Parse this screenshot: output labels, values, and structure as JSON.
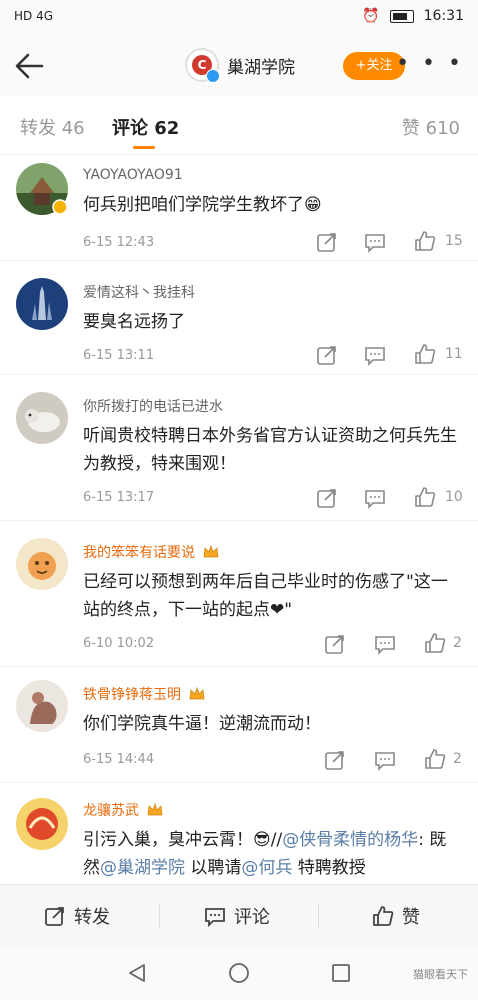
{
  "status": {
    "left": "HD 4G",
    "time": "16:31"
  },
  "header": {
    "account": "巢湖学院",
    "follow": "+关注",
    "more": "• • •"
  },
  "tabs": {
    "repost": "转发 46",
    "comments": "评论 62",
    "likes": "赞 610"
  },
  "comments": [
    {
      "user": "YAOYAOYAO91",
      "text": "何兵别把咱们学院学生教坏了😁",
      "time": "6-15 12:43",
      "likes": "15"
    },
    {
      "user": "爱情这科丶我挂科",
      "text": "要臭名远扬了",
      "time": "6-15 13:11",
      "likes": "11"
    },
    {
      "user": "你所拨打的电话已进水",
      "text": "听闻贵校特聘日本外务省官方认证资助之何兵先生为教授，特来围观！",
      "time": "6-15 13:17",
      "likes": "10"
    },
    {
      "user": "我的笨笨有话要说",
      "text": "已经可以预想到两年后自己毕业时的伤感了\"这一站的终点，下一站的起点❤\"",
      "time": "6-10 10:02",
      "likes": "2"
    },
    {
      "user": "铁骨铮铮蒋玉明",
      "text": "你们学院真牛逼！逆潮流而动！",
      "time": "6-15 14:44",
      "likes": "2"
    },
    {
      "user": "龙骧苏武",
      "text_a": "引污入巢，臭冲云霄！😎//",
      "mention1": "@侠骨柔情的杨华",
      "text_b": ": 既然",
      "mention2": "@巢湖学院",
      "text_c": " 以聘请",
      "mention3": "@何兵",
      "text_d": " 特聘教授"
    }
  ],
  "bottom": {
    "repost": "转发",
    "comment": "评论",
    "like": "赞"
  },
  "watermark": "猫眼看天下",
  "colors": {
    "accent": "#ff8200",
    "follow_bg": "#ff8a00",
    "vip_name": "#e86b0d",
    "mention": "#5a7ea8"
  }
}
